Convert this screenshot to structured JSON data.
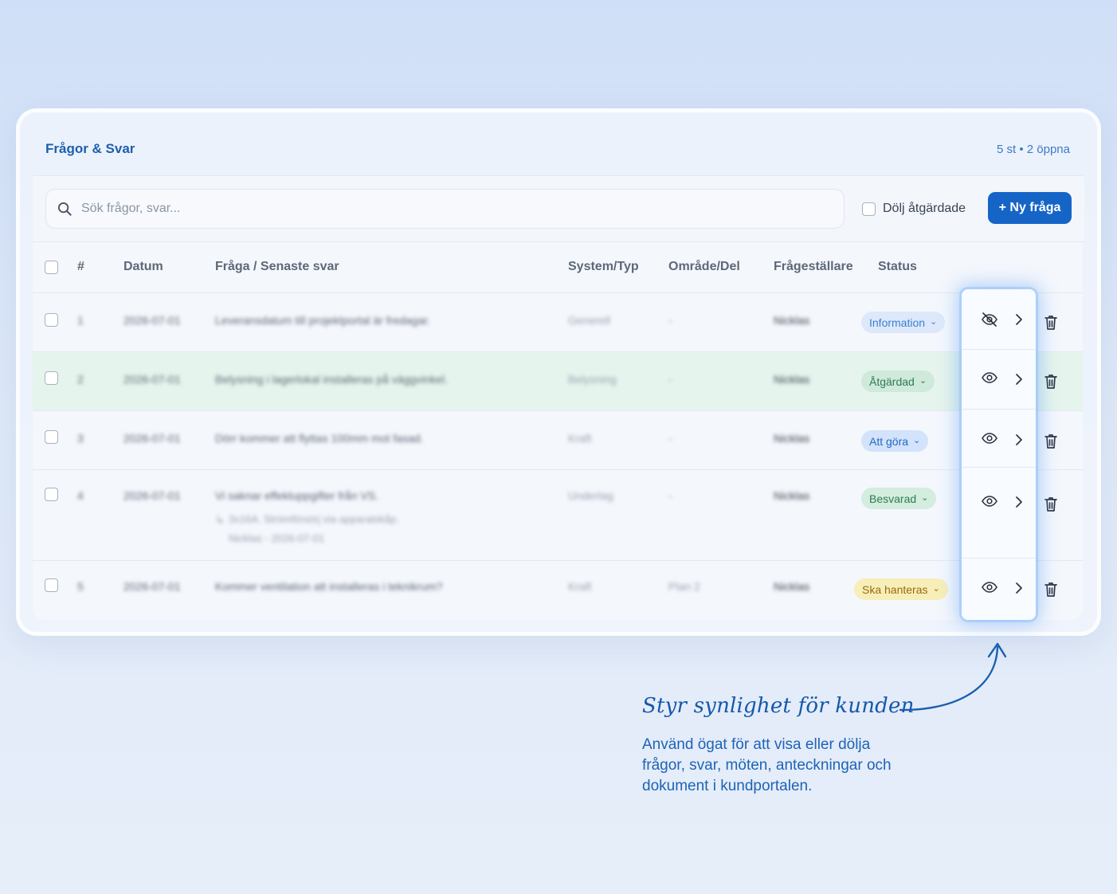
{
  "header": {
    "title": "Frågor & Svar",
    "count": "5 st • 2 öppna"
  },
  "toolbar": {
    "search_placeholder": "Sök frågor, svar...",
    "hide_done_label": "Dölj åtgärdade",
    "new_button_label": "+ Ny fråga"
  },
  "table": {
    "columns": [
      "#",
      "Datum",
      "Fråga / Senaste svar",
      "System/Typ",
      "Område/Del",
      "Frågeställare",
      "Status"
    ],
    "rows": [
      {
        "num": "1",
        "date": "2026-07-01",
        "question": "Leveransdatum till projektportal är fredagar.",
        "system": "Generell",
        "area": "-",
        "asker": "Nicklas",
        "status": "Information",
        "visible": false
      },
      {
        "num": "2",
        "date": "2026-07-01",
        "question": "Belysning i lagerlokal installeras på väggvinkel.",
        "system": "Belysning",
        "area": "-",
        "asker": "Nicklas",
        "status": "Åtgärdad",
        "visible": true
      },
      {
        "num": "3",
        "date": "2026-07-01",
        "question": "Dörr kommer att flyttas 100mm mot fasad.",
        "system": "Kraft",
        "area": "-",
        "asker": "Nicklas",
        "status": "Att göra",
        "visible": true
      },
      {
        "num": "4",
        "date": "2026-07-01",
        "question": "Vi saknar effektuppgifter från VS.",
        "reply": "3x16A. Strömförsörj via apparatskåp.",
        "reply_meta": "Nicklas - 2026-07-01",
        "system": "Underlag",
        "area": "-",
        "asker": "Nicklas",
        "status": "Besvarad",
        "visible": true
      },
      {
        "num": "5",
        "date": "2026-07-01",
        "question": "Kommer ventilation att installeras i teknikrum?",
        "system": "Kraft",
        "area": "Plan 2",
        "asker": "Nicklas",
        "status": "Ska hanteras",
        "visible": true
      }
    ]
  },
  "callout": {
    "title": "Styr synlighet för kunden",
    "text": "Använd ögat för att visa eller dölja frågor, svar, möten, anteckningar och dokument i kundportalen."
  },
  "colors": {
    "accent": "#1565c7",
    "title": "#1c5fae"
  },
  "icons": [
    "search-icon",
    "eye-icon",
    "eye-off-icon",
    "chevron-right-icon",
    "trash-icon",
    "chevron-down-icon",
    "curved-arrow-icon"
  ]
}
